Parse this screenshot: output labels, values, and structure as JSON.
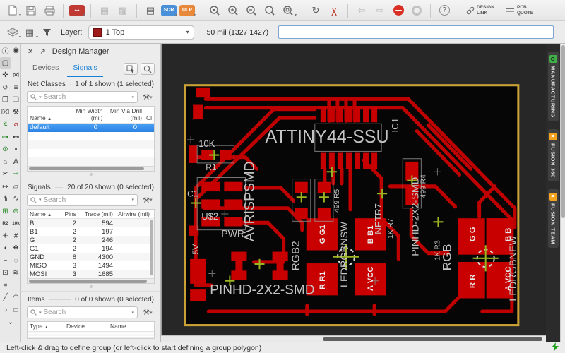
{
  "toolbar_top": {
    "icons": [
      {
        "name": "open-file",
        "type": "svg"
      },
      {
        "name": "save",
        "type": "svg"
      },
      {
        "name": "print",
        "type": "svg"
      },
      {
        "name": "cam-processor",
        "color": "#c03a34"
      },
      {
        "name": "schematic",
        "disabled": true
      },
      {
        "name": "board",
        "disabled": true
      },
      {
        "name": "library",
        "glyph": "▤"
      },
      {
        "name": "run-script",
        "label": "SCR",
        "color": "#4a90d9"
      },
      {
        "name": "run-ulp",
        "label": "ULP",
        "color": "#e8883a"
      },
      {
        "name": "zoom-fit",
        "mark": "▭"
      },
      {
        "name": "zoom-in",
        "mark": "+"
      },
      {
        "name": "zoom-out",
        "mark": "−"
      },
      {
        "name": "zoom-redraw",
        "mark": ""
      },
      {
        "name": "zoom-select",
        "mark": "▫"
      },
      {
        "name": "refresh",
        "glyph": "↻"
      },
      {
        "name": "cancel",
        "glyph": "χ"
      },
      {
        "name": "back",
        "glyph": "⇦",
        "disabled": true
      },
      {
        "name": "forward",
        "glyph": "⇨",
        "disabled": true
      },
      {
        "name": "stop"
      },
      {
        "name": "go",
        "disabled": true
      },
      {
        "name": "help",
        "label": "?"
      },
      {
        "name": "design-link",
        "label": "DESIGN LINK"
      },
      {
        "name": "pcb-quote",
        "label": "PCB QUOTE"
      }
    ]
  },
  "toolbar_layer": {
    "label": "Layer:",
    "selected": "1 Top",
    "swatch_color": "#9e1b1b"
  },
  "coord_bar": {
    "readout": "50 mil (1327 1427)",
    "command_value": ""
  },
  "tool_rail": {
    "icons": [
      {
        "name": "info",
        "glyph": "ⓘ"
      },
      {
        "name": "show",
        "glyph": "◉"
      },
      {
        "name": "group-select",
        "glyph": "▢"
      },
      {
        "name": "spacer",
        "glyph": ""
      },
      {
        "name": "move",
        "glyph": "✛"
      },
      {
        "name": "mirror",
        "glyph": "⋈"
      },
      {
        "name": "rotate",
        "glyph": "↺"
      },
      {
        "name": "align",
        "glyph": "≡"
      },
      {
        "name": "copy",
        "glyph": "❐"
      },
      {
        "name": "paste",
        "glyph": "❏"
      },
      {
        "name": "delete",
        "glyph": "⌧"
      },
      {
        "name": "change",
        "glyph": "⚒"
      },
      {
        "name": "route",
        "glyph": "↯"
      },
      {
        "name": "ripup",
        "glyph": "⌀"
      },
      {
        "name": "route-airwire",
        "glyph": "⊶"
      },
      {
        "name": "unroute",
        "glyph": "⊷"
      },
      {
        "name": "via",
        "glyph": "⊙"
      },
      {
        "name": "pad",
        "glyph": "▪"
      },
      {
        "name": "polygon",
        "glyph": "⌂"
      },
      {
        "name": "text",
        "glyph": "A"
      },
      {
        "name": "ratsnest",
        "glyph": "✂"
      },
      {
        "name": "signal",
        "glyph": "⊸"
      },
      {
        "name": "dimension",
        "glyph": "↦"
      },
      {
        "name": "outline",
        "glyph": "▱"
      },
      {
        "name": "split",
        "glyph": "⋔"
      },
      {
        "name": "meander",
        "glyph": "∿"
      },
      {
        "name": "add-part",
        "glyph": "⊞"
      },
      {
        "name": "add-module",
        "glyph": "⊕"
      },
      {
        "name": "name",
        "glyph": "R2"
      },
      {
        "name": "value",
        "glyph": "10k"
      },
      {
        "name": "smash",
        "glyph": "✳"
      },
      {
        "name": "cage",
        "glyph": "#"
      },
      {
        "name": "eraser",
        "glyph": "◖"
      },
      {
        "name": "attribute",
        "glyph": "❖"
      },
      {
        "name": "bend-style",
        "glyph": "⌐"
      },
      {
        "name": "drc-circle",
        "glyph": "◌"
      },
      {
        "name": "lock",
        "glyph": "⊡"
      },
      {
        "name": "wave",
        "glyph": "≋"
      },
      {
        "name": "dash-style",
        "glyph": "="
      },
      {
        "name": "spacer2",
        "glyph": ""
      },
      {
        "name": "line",
        "glyph": "╱"
      },
      {
        "name": "arc",
        "glyph": "◠"
      },
      {
        "name": "circle",
        "glyph": "○"
      },
      {
        "name": "rect",
        "glyph": "□"
      },
      {
        "name": "more",
        "glyph": "⌄"
      }
    ]
  },
  "design_manager": {
    "title": "Design Manager",
    "close_glyph": "✕",
    "popout_glyph": "↗",
    "tabs": [
      {
        "label": "Devices",
        "active": false
      },
      {
        "label": "Signals",
        "active": true
      }
    ],
    "net_classes": {
      "heading": "Net Classes",
      "count_text": "1 of 1 shown (1 selected)",
      "search_placeholder": "Search",
      "columns": [
        "Name",
        "Min Width (mil)",
        "Min Via Drill (mil)",
        "Cl"
      ],
      "sort_glyph": "▲",
      "rows": [
        {
          "name": "default",
          "min_width": "0",
          "min_via_drill": "0",
          "selected": true
        }
      ]
    },
    "signals": {
      "heading": "Signals",
      "count_text": "20 of 20 shown (0 selected)",
      "search_placeholder": "Search",
      "columns": [
        "Name",
        "Pins",
        "Trace (mil)",
        "Airwire (mil)"
      ],
      "sort_glyph": "▲",
      "rows": [
        {
          "name": "B",
          "pins": "2",
          "trace": "594"
        },
        {
          "name": "B1",
          "pins": "2",
          "trace": "197"
        },
        {
          "name": "G",
          "pins": "2",
          "trace": "246"
        },
        {
          "name": "G1",
          "pins": "2",
          "trace": "194"
        },
        {
          "name": "GND",
          "pins": "8",
          "trace": "4300"
        },
        {
          "name": "MISO",
          "pins": "3",
          "trace": "1494"
        },
        {
          "name": "MOSI",
          "pins": "3",
          "trace": "1685"
        }
      ]
    },
    "items": {
      "heading": "Items",
      "count_text": "0 of 0 shown (0 selected)",
      "search_placeholder": "Search",
      "columns": [
        "Type",
        "Device",
        "Name"
      ],
      "sort_glyph": "▲",
      "rows": []
    }
  },
  "side_tabs": [
    {
      "label": "MANUFACTURING",
      "icon": "manufacturing-chip",
      "icon_color": "#3fae49",
      "icon_glyph": "O"
    },
    {
      "label": "FUSION 360",
      "icon": "fusion-360-chip",
      "icon_color": "#f5a31e",
      "icon_glyph": "F"
    },
    {
      "label": "FUSION TEAM",
      "icon": "fusion-team-chip",
      "icon_color": "#f5a31e",
      "icon_glyph": "F"
    }
  ],
  "status_bar": {
    "message": "Left-click & drag to define group (or left-click to start defining a group polygon)",
    "connection_color": "#21a121"
  },
  "pcb": {
    "colors": {
      "canvas_bg": "#272727",
      "board_bg": "#060606",
      "board_outline": "#c9a135",
      "copper": "#bf0000",
      "silk": "#c4c4c4",
      "crosshair_green": "#9ab520"
    },
    "labels": {
      "attiny": "ATTINY44-SSU",
      "ic1": "IC1",
      "r1_val": "10K",
      "r1": "R1",
      "c1": "C1",
      "u2": "U$2",
      "avrisp": "AVRISPSMD",
      "v5": "5V",
      "pwr": "PWR",
      "pinhd_bottom": "PINHD-2X2-SMD",
      "rgb2": "RGB2",
      "led1_g": "G G1",
      "led1_b": "B B1",
      "led1_r": "R R1",
      "led1_a": "A VCC",
      "lednsw": "LEDRGBNSW",
      "netr7": "NETR7",
      "r7": "1K R7",
      "r5": "499 R5",
      "r4": "499 R4",
      "pinhd_right": "PINHD-2X2-SMD",
      "r3": "1K R3",
      "rgb": "RGB",
      "led2_g": "G G",
      "led2_b": "B B",
      "led2_r": "R R",
      "led2_a": "A VCC",
      "lednew": "LEDRGBNEW"
    }
  }
}
